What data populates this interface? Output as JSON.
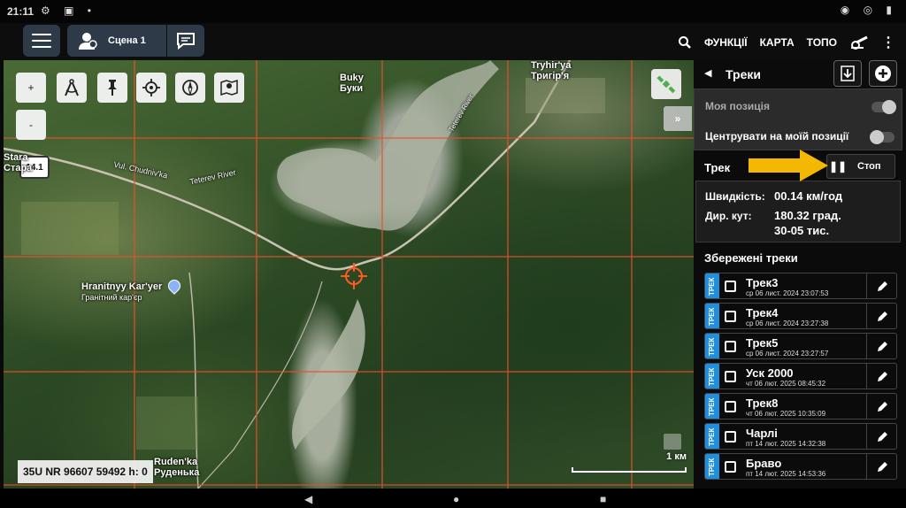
{
  "status_bar": {
    "time": "21:11"
  },
  "topbar": {
    "scene_label": "Сцена 1",
    "nav": [
      "ФУНКЦІЇ",
      "КАРТА",
      "ТОПО"
    ]
  },
  "map": {
    "labels": {
      "buky_en": "Buky",
      "buky_uk": "Буки",
      "tryhir_en": "Tryhir'ya",
      "tryhir_uk": "Тригір'я",
      "teterev_river": "Teterev River",
      "teterev_river2": "Teterev River",
      "street": "Vul. Chudniv'ka",
      "quarry_en": "Hranitnyy Kar'yer",
      "quarry_uk": "Гранітний кар'єр",
      "rudenka_en": "Ruden'ka",
      "rudenka_uk": "Руденька",
      "left_en": "Stara",
      "left_uk": "Стара"
    },
    "zoom_level": "14.1",
    "coordinates": "35U NR 96607 59492 h: 0",
    "scale_label": "1 км",
    "zoom_in": "+",
    "zoom_out": "-"
  },
  "panel": {
    "title": "Треки",
    "my_position_label": "Моя позиція",
    "center_label": "Центрувати на моїй позиції",
    "track_label": "Трек",
    "stop_label": "Стоп",
    "speed_key": "Швидкість:",
    "speed_value": "00.14 км/год",
    "dir_key": "Дир. кут:",
    "dir_value1": "180.32 град.",
    "dir_value2": "30-05 тис.",
    "saved_header": "Збережені треки",
    "tag_label": "ТРЕК",
    "tracks": [
      {
        "name": "Трек3",
        "date": "ср 06 лист. 2024 23:07:53"
      },
      {
        "name": "Трек4",
        "date": "ср 06 лист. 2024 23:27:38"
      },
      {
        "name": "Трек5",
        "date": "ср 06 лист. 2024 23:27:57"
      },
      {
        "name": "Уск 2000",
        "date": "чт 06 лют. 2025 08:45:32"
      },
      {
        "name": "Трек8",
        "date": "чт 06 лют. 2025 10:35:09"
      },
      {
        "name": "Чарлі",
        "date": "пт 14 лют. 2025 14:32:38"
      },
      {
        "name": "Браво",
        "date": "пт 14 лют. 2025 14:53:36"
      }
    ]
  },
  "colors": {
    "accent": "#1f8fe0",
    "grid": "#e8502a",
    "arrow": "#f5b800",
    "button_bg": "#2e3a48"
  }
}
